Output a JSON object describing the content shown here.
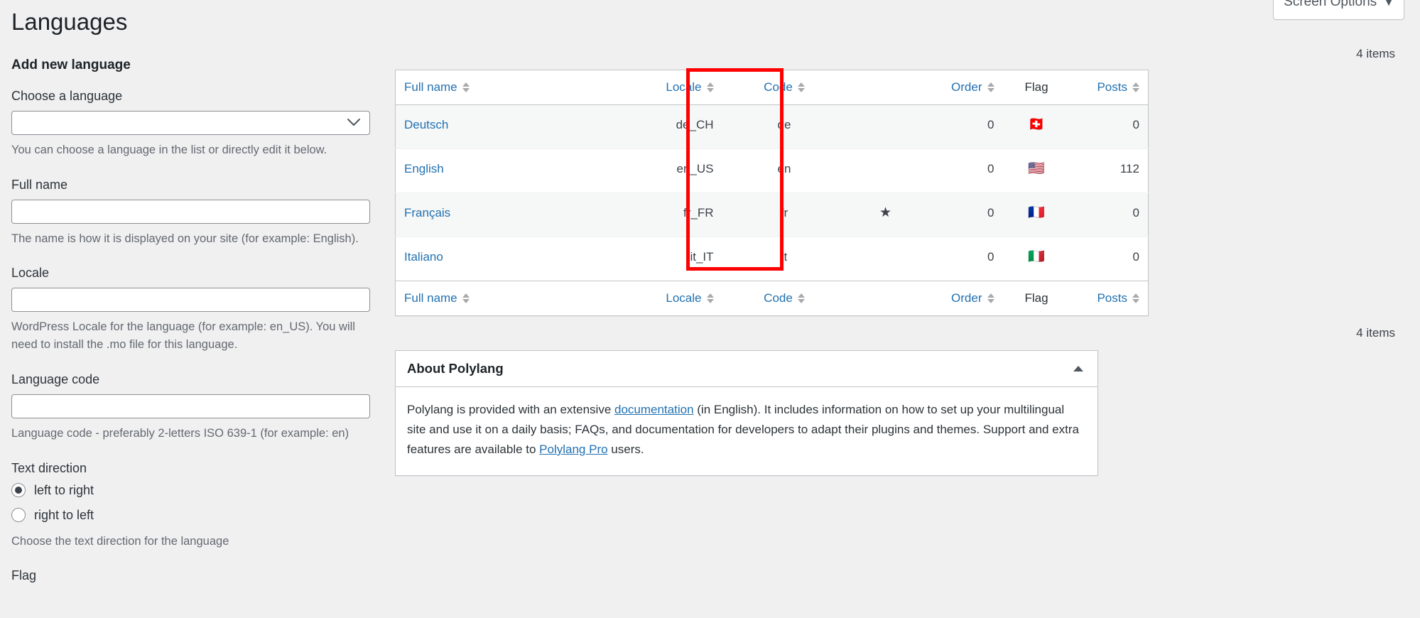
{
  "header": {
    "page_title": "Languages",
    "screen_options_label": "Screen Options",
    "screen_options_caret": "▼"
  },
  "add_language_form": {
    "section_title": "Add new language",
    "choose_language": {
      "label": "Choose a language",
      "value": "",
      "help": "You can choose a language in the list or directly edit it below.",
      "chevron_icon": "chevron-down-icon"
    },
    "full_name": {
      "label": "Full name",
      "value": "",
      "help": "The name is how it is displayed on your site (for example: English)."
    },
    "locale": {
      "label": "Locale",
      "value": "",
      "help": "WordPress Locale for the language (for example: en_US). You will need to install the .mo file for this language."
    },
    "language_code": {
      "label": "Language code",
      "value": "",
      "help": "Language code - preferably 2-letters ISO 639-1 (for example: en)"
    },
    "text_direction": {
      "label": "Text direction",
      "options": [
        {
          "label": "left to right",
          "checked": true
        },
        {
          "label": "right to left",
          "checked": false
        }
      ],
      "help": "Choose the text direction for the language"
    },
    "flag": {
      "label": "Flag"
    }
  },
  "languages_table": {
    "items_count_top": "4 items",
    "items_count_bottom": "4 items",
    "columns": [
      {
        "key": "full_name",
        "label": "Full name",
        "sortable": true
      },
      {
        "key": "locale",
        "label": "Locale",
        "sortable": true
      },
      {
        "key": "code",
        "label": "Code",
        "sortable": true
      },
      {
        "key": "default",
        "label": "",
        "sortable": false
      },
      {
        "key": "order",
        "label": "Order",
        "sortable": true
      },
      {
        "key": "flag",
        "label": "Flag",
        "sortable": false
      },
      {
        "key": "posts",
        "label": "Posts",
        "sortable": true
      }
    ],
    "rows": [
      {
        "full_name": "Deutsch",
        "locale": "de_CH",
        "code": "de",
        "is_default": false,
        "default_marker": "",
        "order": "0",
        "flag": "🇨🇭",
        "flag_name": "flag-switzerland-icon",
        "posts": "0"
      },
      {
        "full_name": "English",
        "locale": "en_US",
        "code": "en",
        "is_default": false,
        "default_marker": "",
        "order": "0",
        "flag": "🇺🇸",
        "flag_name": "flag-united-states-icon",
        "posts": "112"
      },
      {
        "full_name": "Français",
        "locale": "fr_FR",
        "code": "fr",
        "is_default": true,
        "default_marker": "★",
        "order": "0",
        "flag": "🇫🇷",
        "flag_name": "flag-france-icon",
        "posts": "0"
      },
      {
        "full_name": "Italiano",
        "locale": "it_IT",
        "code": "it",
        "is_default": false,
        "default_marker": "",
        "order": "0",
        "flag": "🇮🇹",
        "flag_name": "flag-italy-icon",
        "posts": "0"
      }
    ]
  },
  "about_box": {
    "title": "About Polylang",
    "toggle_icon": "chevron-up-icon",
    "text_part_1": "Polylang is provided with an extensive ",
    "link_documentation": "documentation",
    "text_part_2": " (in English). It includes information on how to set up your multilingual site and use it on a daily basis; FAQs, and documentation for developers to adapt their plugins and themes. Support and extra features are available to ",
    "link_polylang_pro": "Polylang Pro",
    "text_part_3": " users."
  },
  "annotation": {
    "type": "red-rectangle-highlight",
    "target_column": "Code",
    "color": "#ff0000"
  },
  "colors": {
    "background": "#f0f0f1",
    "link": "#2271b1",
    "text": "#3c434a",
    "border": "#c3c4c7",
    "annotation": "#ff0000"
  }
}
